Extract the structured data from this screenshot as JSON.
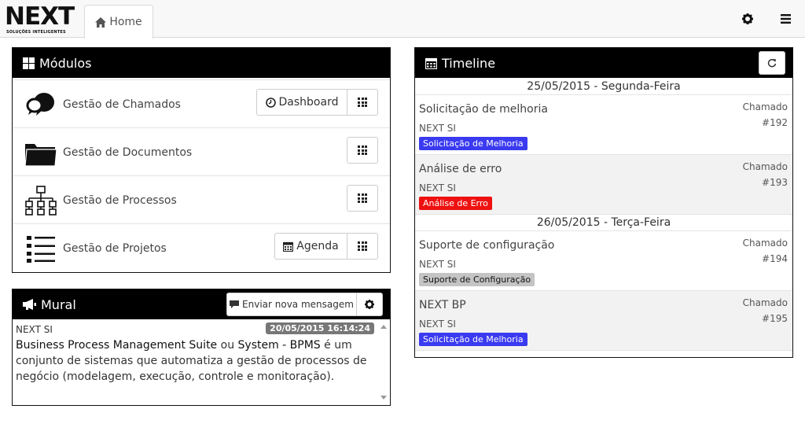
{
  "logo": {
    "word": "NEXT",
    "tagline": "SOLUÇÕES INTELIGENTES"
  },
  "tabs": [
    {
      "label": "Home",
      "icon": "home-icon"
    }
  ],
  "topbar_icons": [
    "gear-icon",
    "hamburger-menu-icon"
  ],
  "modules": {
    "title": "Módulos",
    "items": [
      {
        "label": "Gestão de Chamados",
        "icon": "chat-bubbles-icon",
        "extra_button": "Dashboard",
        "extra_icon": "clock-icon"
      },
      {
        "label": "Gestão de Documentos",
        "icon": "folder-icon"
      },
      {
        "label": "Gestão de Processos",
        "icon": "sitemap-icon"
      },
      {
        "label": "Gestão de Projetos",
        "icon": "list-icon",
        "extra_button": "Agenda",
        "extra_icon": "calendar-icon"
      }
    ]
  },
  "mural": {
    "title": "Mural",
    "send_button": "Enviar nova mensagem",
    "post": {
      "author": "NEXT SI",
      "date": "20/05/2015 16:14:24",
      "text_strong_1": "Business Process Management Suite",
      "text_mid": " ou ",
      "text_strong_2": "System - BPMS",
      "text_rest": " é um conjunto de sistemas que automatiza a gestão de processos de negócio (modelagem, execução, controle e monitoração)."
    }
  },
  "timeline": {
    "title": "Timeline",
    "groups": [
      {
        "date": "25/05/2015 - Segunda-Feira",
        "items": [
          {
            "title": "Solicitação de melhoria",
            "org": "NEXT SI",
            "badge": "Solicitação de Melhoria",
            "badge_color": "#3a3af0",
            "type": "Chamado",
            "number": "#192"
          },
          {
            "title": "Análise de erro",
            "org": "NEXT SI",
            "badge": "Análise de Erro",
            "badge_color": "#ee1111",
            "type": "Chamado",
            "number": "#193"
          }
        ]
      },
      {
        "date": "26/05/2015 - Terça-Feira",
        "items": [
          {
            "title": "Suporte de configuração",
            "org": "NEXT SI",
            "badge": "Suporte de Configuração",
            "badge_color": "#c4c4c4",
            "type": "Chamado",
            "number": "#194"
          },
          {
            "title": "NEXT BP",
            "org": "NEXT SI",
            "badge": "Solicitação de Melhoria",
            "badge_color": "#3a3af0",
            "type": "Chamado",
            "number": "#195"
          }
        ]
      }
    ]
  }
}
